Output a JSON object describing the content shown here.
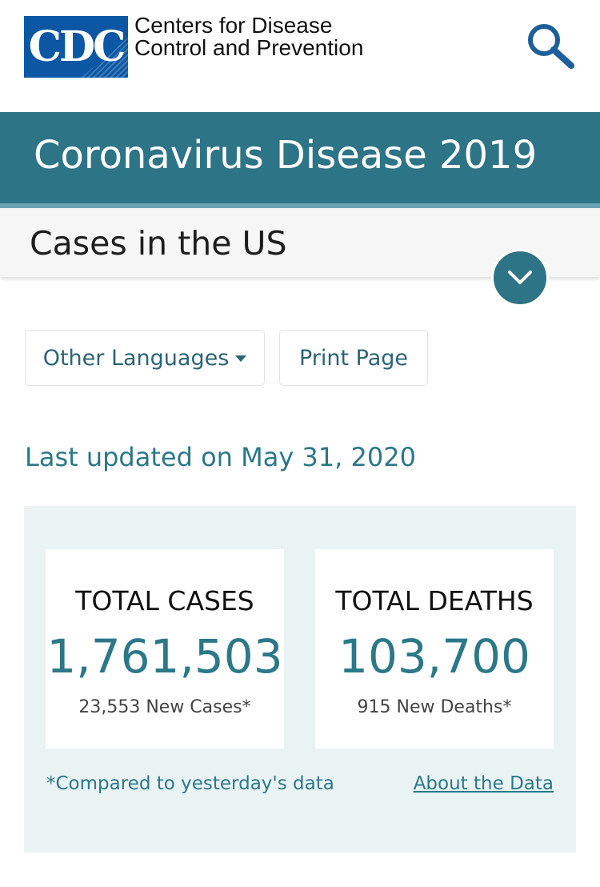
{
  "header": {
    "logo_text": "CDC",
    "agency_line1": "Centers for Disease",
    "agency_line2": "Control and Prevention",
    "search_icon": "search-icon"
  },
  "banner": {
    "title": "Coronavirus Disease 2019"
  },
  "section": {
    "title": "Cases in the US",
    "toggle_icon": "chevron-down-icon"
  },
  "actions": {
    "languages_label": "Other Languages",
    "print_label": "Print Page"
  },
  "updated_text": "Last updated on May 31, 2020",
  "stats": {
    "cases": {
      "label": "TOTAL CASES",
      "value": "1,761,503",
      "sub": "23,553 New Cases*"
    },
    "deaths": {
      "label": "TOTAL DEATHS",
      "value": "103,700",
      "sub": "915 New Deaths*"
    },
    "footnote": "*Compared to yesterday's data",
    "about_link": "About the Data"
  },
  "colors": {
    "brand_blue": "#0b57a4",
    "teal": "#2d7486",
    "accent_text": "#2b7889",
    "panel_bg": "#e9f3f4"
  }
}
